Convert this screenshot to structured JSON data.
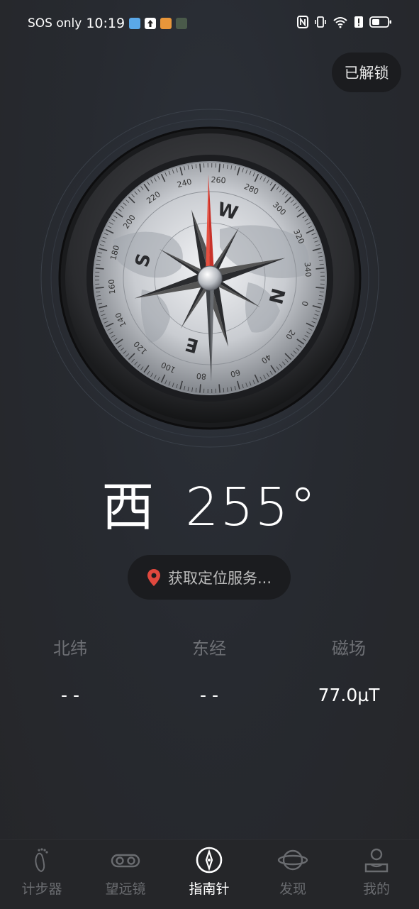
{
  "status_bar": {
    "carrier": "SOS only",
    "time": "10:19",
    "icons": [
      "gallery-app-icon",
      "upload-app-icon",
      "game-app-icon",
      "robot-app-icon",
      "nfc-icon",
      "vibrate-icon",
      "wifi-icon",
      "alert-icon",
      "battery-icon"
    ],
    "battery_level": 0.4
  },
  "header": {
    "unlock_label": "已解锁"
  },
  "compass": {
    "ticks": [
      "260",
      "280",
      "300",
      "320",
      "340",
      "0",
      "20",
      "40",
      "60",
      "80",
      "100",
      "120",
      "140",
      "160",
      "180",
      "200",
      "220",
      "240"
    ],
    "cardinals": [
      "W",
      "N",
      "E",
      "S"
    ],
    "heading_degrees": 255
  },
  "reading": {
    "direction": "西",
    "degrees": "255°"
  },
  "location": {
    "label": "获取定位服务..."
  },
  "stats": [
    {
      "label": "北纬",
      "value": "- -"
    },
    {
      "label": "东经",
      "value": "- -"
    },
    {
      "label": "磁场",
      "value": "77.0µT"
    }
  ],
  "nav": [
    {
      "label": "计步器",
      "icon": "footprint-icon",
      "active": false
    },
    {
      "label": "望远镜",
      "icon": "binoculars-icon",
      "active": false
    },
    {
      "label": "指南针",
      "icon": "compass-icon",
      "active": true
    },
    {
      "label": "发现",
      "icon": "planet-icon",
      "active": false
    },
    {
      "label": "我的",
      "icon": "profile-icon",
      "active": false
    }
  ],
  "colors": {
    "accent_red": "#d93a2b",
    "pin_red": "#e0483e",
    "muted_text": "#6e7075"
  }
}
